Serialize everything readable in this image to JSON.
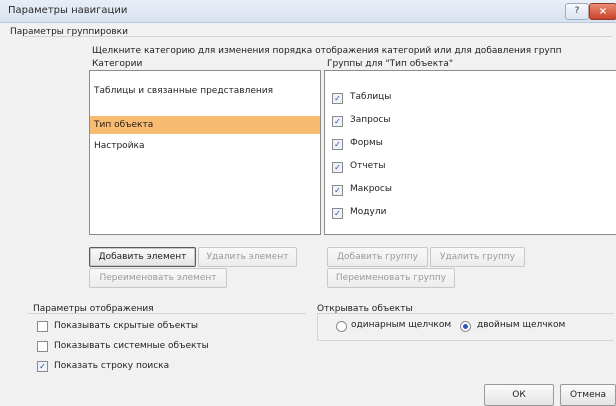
{
  "window": {
    "title": "Параметры навигации",
    "help_label": "?",
    "close_label": "×"
  },
  "grouping": {
    "section_label": "Параметры группировки",
    "instruction": "Щелкните категорию для изменения порядка отображения категорий или для добавления групп",
    "categories_header": "Категории",
    "groups_header": "Группы для \"Тип объекта\"",
    "categories": [
      {
        "label": "Таблицы и связанные представления",
        "selected": false
      },
      {
        "label": "Тип объекта",
        "selected": true
      },
      {
        "label": "Настройка",
        "selected": false
      }
    ],
    "groups": [
      {
        "label": "Таблицы",
        "checked": true
      },
      {
        "label": "Запросы",
        "checked": true
      },
      {
        "label": "Формы",
        "checked": true
      },
      {
        "label": "Отчеты",
        "checked": true
      },
      {
        "label": "Макросы",
        "checked": true
      },
      {
        "label": "Модули",
        "checked": true
      }
    ],
    "add_item_label": "Добавить элемент",
    "delete_item_label": "Удалить элемент",
    "rename_item_label": "Переименовать элемент",
    "add_group_label": "Добавить группу",
    "delete_group_label": "Удалить группу",
    "rename_group_label": "Переименовать группу"
  },
  "display": {
    "section_label": "Параметры отображения",
    "options": [
      {
        "label": "Показывать скрытые объекты",
        "checked": false
      },
      {
        "label": "Показывать системные объекты",
        "checked": false
      },
      {
        "label": "Показать строку поиска",
        "checked": true
      }
    ]
  },
  "open": {
    "section_label": "Открывать объекты",
    "single_click_label": "одинарным щелчком",
    "double_click_label": "двойным щелчком",
    "selected": "double"
  },
  "footer": {
    "ok_label": "ОК",
    "cancel_label": "Отмена"
  },
  "check_glyph": "✓"
}
